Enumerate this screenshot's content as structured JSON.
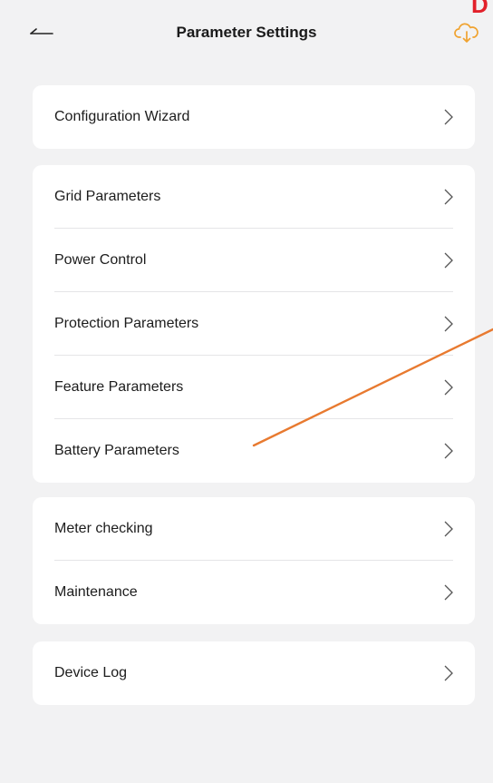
{
  "header": {
    "title": "Parameter Settings",
    "back_icon": "back-arrow-icon",
    "action_icon": "cloud-download-icon",
    "corner_text": "D"
  },
  "groups": [
    {
      "items": [
        {
          "label": "Configuration Wizard",
          "icon": "chevron-right-icon"
        }
      ]
    },
    {
      "items": [
        {
          "label": "Grid Parameters",
          "icon": "chevron-right-icon"
        },
        {
          "label": "Power Control",
          "icon": "chevron-right-icon"
        },
        {
          "label": "Protection Parameters",
          "icon": "chevron-right-icon"
        },
        {
          "label": "Feature Parameters",
          "icon": "chevron-right-icon"
        },
        {
          "label": "Battery Parameters",
          "icon": "chevron-right-icon"
        }
      ]
    },
    {
      "items": [
        {
          "label": "Meter checking",
          "icon": "chevron-right-icon"
        },
        {
          "label": "Maintenance",
          "icon": "chevron-right-icon"
        }
      ]
    },
    {
      "items": [
        {
          "label": "Device Log",
          "icon": "chevron-right-icon"
        }
      ]
    }
  ],
  "colors": {
    "accent": "#f0a330",
    "annotation": "#e87a30",
    "brand_red": "#e2202a",
    "background": "#f2f2f3",
    "card": "#ffffff"
  }
}
